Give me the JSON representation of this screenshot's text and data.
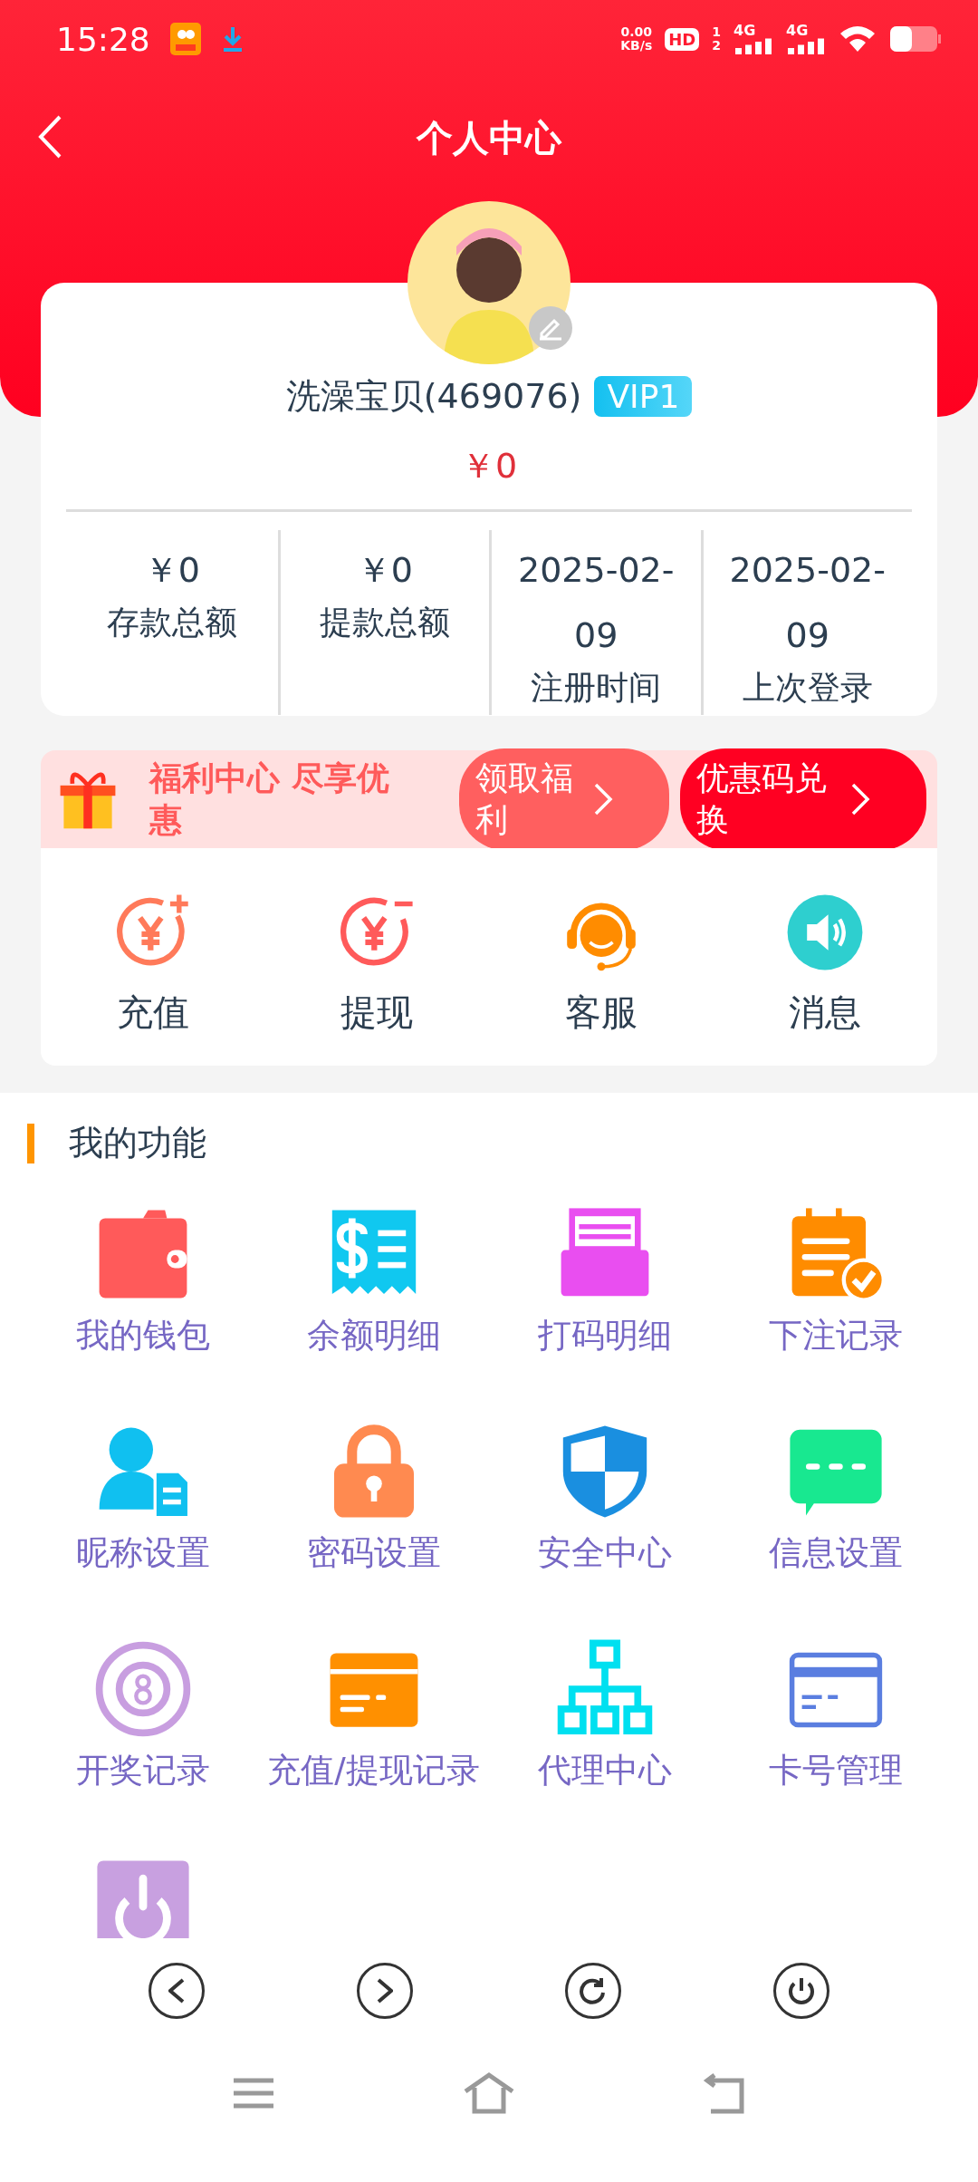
{
  "status_bar": {
    "time": "15:28",
    "speed": [
      "0.00",
      "KB/s"
    ],
    "hd": "HD",
    "sims": [
      "1",
      "2"
    ],
    "networks": [
      "4G",
      "4G"
    ]
  },
  "header": {
    "title": "个人中心"
  },
  "profile": {
    "name": "洗澡宝贝(469076)",
    "vip": "VIP1",
    "balance": "￥0",
    "stats": [
      {
        "value": "￥0",
        "label": "存款总额"
      },
      {
        "value": "￥0",
        "label": "提款总额"
      },
      {
        "value": "2025-02-09",
        "label": "注册时间"
      },
      {
        "value": "2025-02-09",
        "label": "上次登录"
      }
    ]
  },
  "banner": {
    "text": "福利中心 尽享优惠",
    "buttons": [
      {
        "label": "领取福利",
        "color": "#ff5f5f"
      },
      {
        "label": "优惠码兑换",
        "color": "#ff0022"
      }
    ]
  },
  "quick_actions": [
    {
      "label": "充值"
    },
    {
      "label": "提现"
    },
    {
      "label": "客服"
    },
    {
      "label": "消息"
    }
  ],
  "functions": {
    "title": "我的功能",
    "items": [
      {
        "kind": "labeled",
        "label": "我的钱包"
      },
      {
        "kind": "labeled",
        "label": "余额明细"
      },
      {
        "kind": "labeled",
        "label": "打码明细"
      },
      {
        "kind": "labeled",
        "label": "下注记录"
      },
      {
        "kind": "labeled",
        "label": "昵称设置"
      },
      {
        "kind": "labeled",
        "label": "密码设置"
      },
      {
        "kind": "labeled",
        "label": "安全中心"
      },
      {
        "kind": "labeled",
        "label": "信息设置"
      },
      {
        "kind": "labeled",
        "label": "开奖记录"
      },
      {
        "kind": "labeled",
        "label": "充值/提现记录"
      },
      {
        "kind": "labeled",
        "label": "代理中心"
      },
      {
        "kind": "labeled",
        "label": "卡号管理"
      },
      {
        "kind": "icon"
      }
    ]
  }
}
